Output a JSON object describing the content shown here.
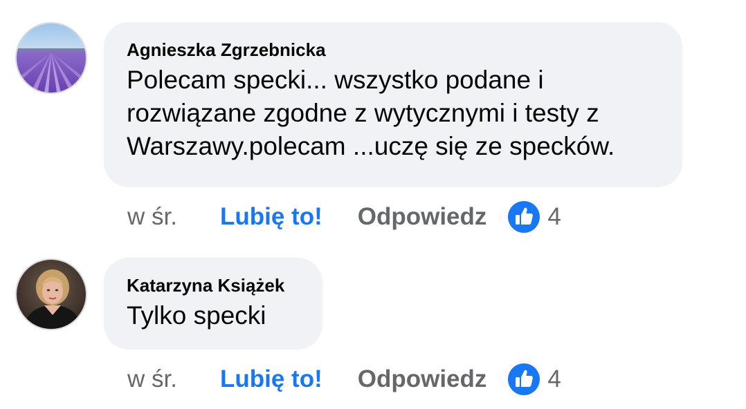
{
  "comments": [
    {
      "author": "Agnieszka Zgrzebnicka",
      "text": "Polecam specki... wszystko podane i\nrozwiązane zgodne z wytycznymi i testy z\nWarszawy.polecam ...uczę się ze specków.",
      "time": "w śr.",
      "like_label": "Lubię to!",
      "reply_label": "Odpowiedz",
      "reaction_count": "4",
      "avatar": "lavender-field-photo",
      "reaction_icon": "like-thumbs-up-icon"
    },
    {
      "author": "Katarzyna Książek",
      "text": "Tylko specki",
      "time": "w śr.",
      "like_label": "Lubię to!",
      "reply_label": "Odpowiedz",
      "reaction_count": "4",
      "avatar": "woman-portrait-photo",
      "reaction_icon": "like-thumbs-up-icon"
    }
  ],
  "colors": {
    "bubble_background": "#f0f2f5",
    "like_blue": "#1877f2",
    "secondary_text": "#65676b",
    "primary_text": "#050505"
  }
}
